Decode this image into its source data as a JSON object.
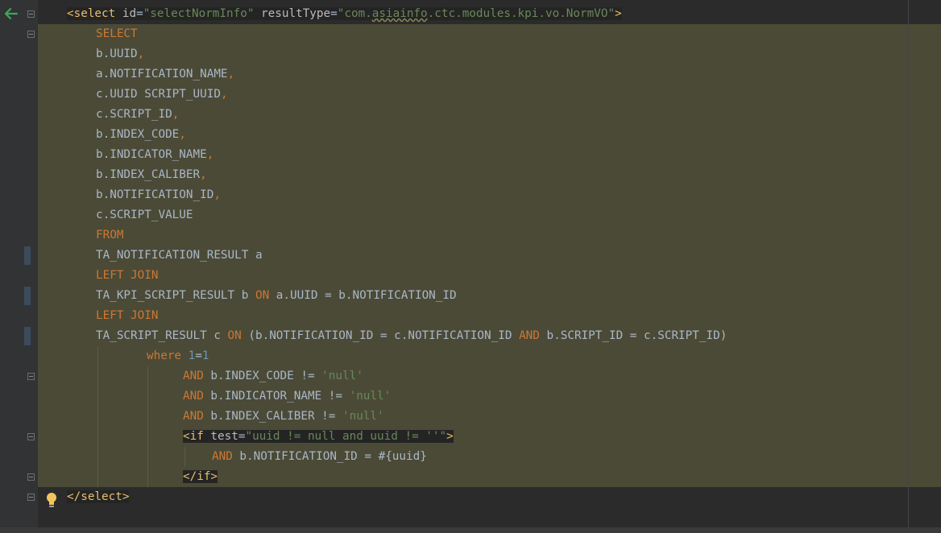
{
  "editor": {
    "lines": [
      {
        "indent": 36,
        "tokens": [
          {
            "t": "<select",
            "c": "tag hl"
          },
          {
            "t": " id",
            "c": "attr hl"
          },
          {
            "t": "=",
            "c": "hl"
          },
          {
            "t": "\"selectNormInfo\"",
            "c": "str hl"
          },
          {
            "t": " resultType",
            "c": "attr hl"
          },
          {
            "t": "=",
            "c": "hl"
          },
          {
            "t": "\"com.",
            "c": "str hl"
          },
          {
            "t": "asiainfo",
            "c": "str hl squiggle"
          },
          {
            "t": ".ctc.modules.kpi.vo.NormVO\"",
            "c": "str hl"
          },
          {
            "t": ">",
            "c": "tag hl"
          }
        ]
      },
      {
        "indent": 72,
        "tokens": [
          {
            "t": "SELECT",
            "c": "kw"
          }
        ]
      },
      {
        "indent": 72,
        "tokens": [
          {
            "t": "b.UUID"
          },
          {
            "t": ",",
            "c": "punct"
          }
        ]
      },
      {
        "indent": 72,
        "tokens": [
          {
            "t": "a.NOTIFICATION_NAME"
          },
          {
            "t": ",",
            "c": "punct"
          }
        ]
      },
      {
        "indent": 72,
        "tokens": [
          {
            "t": "c.UUID SCRIPT_UUID"
          },
          {
            "t": ",",
            "c": "punct"
          }
        ]
      },
      {
        "indent": 72,
        "tokens": [
          {
            "t": "c.SCRIPT_ID"
          },
          {
            "t": ",",
            "c": "punct"
          }
        ]
      },
      {
        "indent": 72,
        "tokens": [
          {
            "t": "b.INDEX_CODE"
          },
          {
            "t": ",",
            "c": "punct"
          }
        ]
      },
      {
        "indent": 72,
        "tokens": [
          {
            "t": "b.INDICATOR_NAME"
          },
          {
            "t": ",",
            "c": "punct"
          }
        ]
      },
      {
        "indent": 72,
        "tokens": [
          {
            "t": "b.INDEX_CALIBER"
          },
          {
            "t": ",",
            "c": "punct"
          }
        ]
      },
      {
        "indent": 72,
        "tokens": [
          {
            "t": "b.NOTIFICATION_ID"
          },
          {
            "t": ",",
            "c": "punct"
          }
        ]
      },
      {
        "indent": 72,
        "tokens": [
          {
            "t": "c.SCRIPT_VALUE"
          }
        ]
      },
      {
        "indent": 72,
        "tokens": [
          {
            "t": "FROM",
            "c": "kw"
          }
        ]
      },
      {
        "indent": 72,
        "tokens": [
          {
            "t": "TA_NOTIFICATION_RESULT a"
          }
        ]
      },
      {
        "indent": 72,
        "tokens": [
          {
            "t": "LEFT JOIN",
            "c": "kw"
          }
        ]
      },
      {
        "indent": 72,
        "tokens": [
          {
            "t": "TA_KPI_SCRIPT_RESULT b "
          },
          {
            "t": "ON",
            "c": "kw"
          },
          {
            "t": " a.UUID = b.NOTIFICATION_ID"
          }
        ]
      },
      {
        "indent": 72,
        "tokens": [
          {
            "t": "LEFT JOIN",
            "c": "kw"
          }
        ]
      },
      {
        "indent": 72,
        "tokens": [
          {
            "t": "TA_SCRIPT_RESULT c "
          },
          {
            "t": "ON",
            "c": "kw"
          },
          {
            "t": " (b.NOTIFICATION_ID = c.NOTIFICATION_ID "
          },
          {
            "t": "AND",
            "c": "kw"
          },
          {
            "t": " b.SCRIPT_ID = c.SCRIPT_ID)"
          }
        ]
      },
      {
        "indent": 135,
        "tokens": [
          {
            "t": "where",
            "c": "kw"
          },
          {
            "t": " "
          },
          {
            "t": "1",
            "c": "num"
          },
          {
            "t": "="
          },
          {
            "t": "1",
            "c": "num"
          }
        ]
      },
      {
        "indent": 180,
        "tokens": [
          {
            "t": "AND",
            "c": "kw"
          },
          {
            "t": " b.INDEX_CODE != "
          },
          {
            "t": "'null'",
            "c": "str"
          }
        ]
      },
      {
        "indent": 180,
        "tokens": [
          {
            "t": "AND",
            "c": "kw"
          },
          {
            "t": " b.INDICATOR_NAME != "
          },
          {
            "t": "'null'",
            "c": "str"
          }
        ]
      },
      {
        "indent": 180,
        "tokens": [
          {
            "t": "AND",
            "c": "kw"
          },
          {
            "t": " b.INDEX_CALIBER != "
          },
          {
            "t": "'null'",
            "c": "str"
          }
        ]
      },
      {
        "indent": 180,
        "tokens": [
          {
            "t": "<if",
            "c": "tag hl"
          },
          {
            "t": " test",
            "c": "attr hl"
          },
          {
            "t": "=",
            "c": "hl"
          },
          {
            "t": "\"uuid != null and uuid != ''\"",
            "c": "str hl"
          },
          {
            "t": ">",
            "c": "tag hl"
          }
        ]
      },
      {
        "indent": 216,
        "tokens": [
          {
            "t": "AND",
            "c": "kw"
          },
          {
            "t": " b.NOTIFICATION_ID = #{uuid}"
          }
        ]
      },
      {
        "indent": 180,
        "tokens": [
          {
            "t": "</if>",
            "c": "tag hl"
          }
        ]
      },
      {
        "indent": 36,
        "tokens": [
          {
            "t": "</select>",
            "c": "tag hl"
          }
        ]
      }
    ]
  },
  "gutter": {
    "navigate_icon": "arrow-left-icon",
    "intention_icon": "lightbulb-icon"
  },
  "colors": {
    "keyword": "#cc7832",
    "string": "#6a8759",
    "number": "#6897bb",
    "tag": "#e8bf6a",
    "injected_sql_background": "#4b4a37"
  }
}
